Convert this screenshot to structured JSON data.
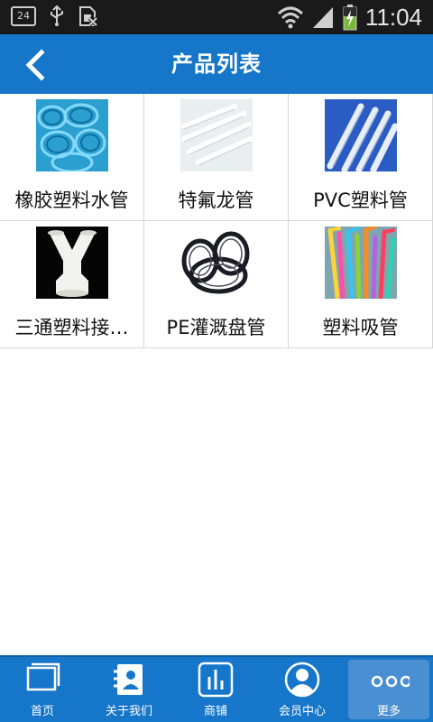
{
  "status_bar": {
    "notification_count": "24",
    "time": "11:04",
    "icons": [
      "usb-icon",
      "sim-icon",
      "wifi-icon",
      "signal-icon",
      "battery-charging-icon"
    ]
  },
  "header": {
    "title": "产品列表",
    "back_icon": "chevron-left-icon"
  },
  "products": [
    {
      "label": "橡胶塑料水管",
      "image": "blue-hoses-image"
    },
    {
      "label": "特氟龙管",
      "image": "white-tubes-image"
    },
    {
      "label": "PVC塑料管",
      "image": "pvc-pipes-image"
    },
    {
      "label": "三通塑料接…",
      "image": "y-connector-image"
    },
    {
      "label": "PE灌溉盘管",
      "image": "black-coils-image"
    },
    {
      "label": "塑料吸管",
      "image": "straws-image"
    }
  ],
  "bottom_nav": [
    {
      "label": "首页",
      "icon": "home-pages-icon"
    },
    {
      "label": "关于我们",
      "icon": "contact-card-icon"
    },
    {
      "label": "商铺",
      "icon": "bar-chart-icon"
    },
    {
      "label": "会员中心",
      "icon": "user-icon"
    },
    {
      "label": "更多",
      "icon": "more-dots-icon",
      "active": true
    }
  ],
  "colors": {
    "primary": "#1676c9",
    "status_bar": "#1a1a1a",
    "nav_active": "#4a8fd2"
  }
}
